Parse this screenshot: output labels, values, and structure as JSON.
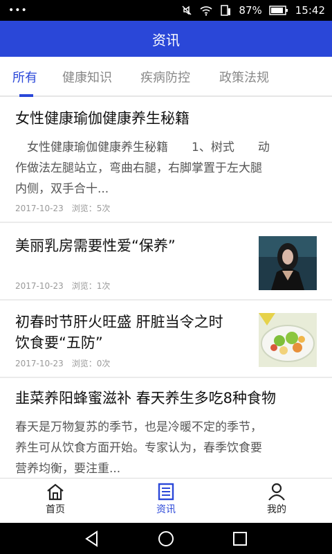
{
  "status_bar": {
    "battery": "87%",
    "time": "15:42"
  },
  "app_bar": {
    "title": "资讯"
  },
  "tabs": [
    {
      "label": "所有",
      "active": true
    },
    {
      "label": "健康知识",
      "active": false
    },
    {
      "label": "疾病防控",
      "active": false
    },
    {
      "label": "政策法规",
      "active": false
    }
  ],
  "articles": [
    {
      "title": "女性健康瑜伽健康养生秘籍",
      "excerpt_lines": [
        "　女性健康瑜伽健康养生秘籍　　1、树式　　动",
        "作做法左腿站立，弯曲右腿，右脚掌置于左大腿",
        "内侧，双手合十..."
      ],
      "date": "2017-10-23",
      "views": "浏览：5次"
    },
    {
      "title": "美丽乳房需要性爱“保养”",
      "date": "2017-10-23",
      "views": "浏览：1次"
    },
    {
      "title_lines": [
        "初春时节肝火旺盛 肝脏当令之时",
        "饮食要“五防”"
      ],
      "date": "2017-10-23",
      "views": "浏览：0次"
    },
    {
      "title": "韭菜养阳蜂蜜滋补 春天养生多吃8种食物",
      "excerpt_lines": [
        "春天是万物复苏的季节，也是冷暖不定的季节，",
        "养生可从饮食方面开始。专家认为，春季饮食要",
        "营养均衡，要注重..."
      ]
    }
  ],
  "bottom_nav": [
    {
      "label": "首页",
      "icon": "home-icon",
      "active": false
    },
    {
      "label": "资讯",
      "icon": "news-icon",
      "active": true
    },
    {
      "label": "我的",
      "icon": "person-icon",
      "active": false
    }
  ],
  "colors": {
    "primary": "#2a47d8",
    "background": "#ebebeb"
  }
}
